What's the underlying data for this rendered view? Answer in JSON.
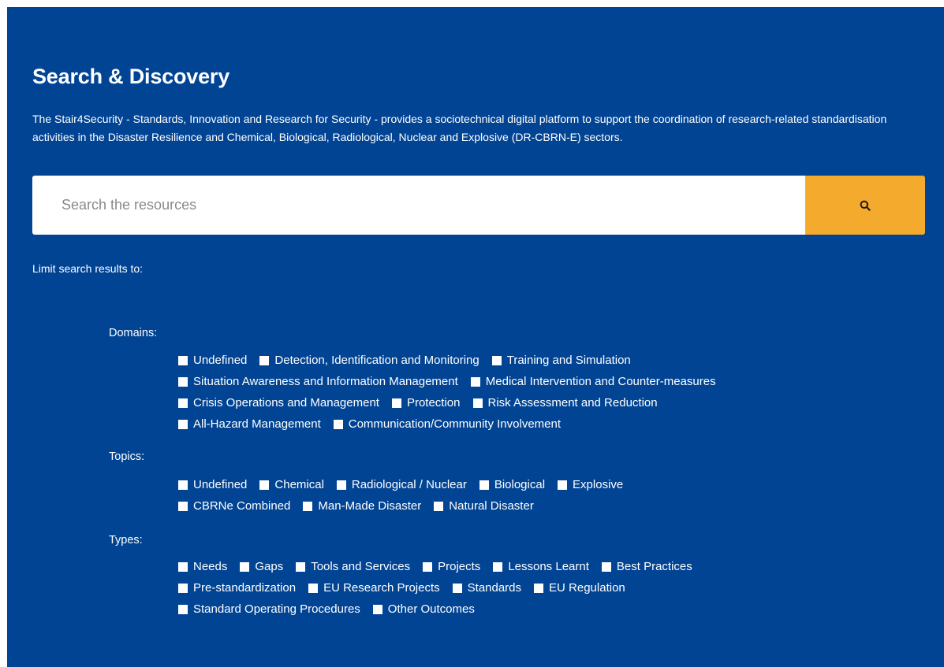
{
  "header": {
    "title": "Search & Discovery",
    "description": "The Stair4Security - Standards, Innovation and Research for Security - provides a sociotechnical digital platform to support the coordination of research-related standardisation activities in the Disaster Resilience and Chemical, Biological, Radiological, Nuclear and Explosive (DR-CBRN-E) sectors."
  },
  "search": {
    "placeholder": "Search the resources",
    "value": "",
    "button_icon": "search-icon"
  },
  "colors": {
    "background": "#024494",
    "accent": "#f4aa2c",
    "text": "#ffffff"
  },
  "filters": {
    "label": "Limit search results to:",
    "domains": {
      "label": "Domains:",
      "rows": [
        [
          "Undefined",
          "Detection, Identification and Monitoring",
          "Training and Simulation"
        ],
        [
          "Situation Awareness and Information Management",
          "Medical Intervention and Counter-measures"
        ],
        [
          "Crisis Operations and Management",
          "Protection",
          "Risk Assessment and Reduction"
        ],
        [
          "All-Hazard Management",
          "Communication/Community Involvement"
        ]
      ]
    },
    "topics": {
      "label": "Topics:",
      "rows": [
        [
          "Undefined",
          "Chemical",
          "Radiological / Nuclear",
          "Biological",
          "Explosive"
        ],
        [
          "CBRNe Combined",
          "Man-Made Disaster",
          "Natural Disaster"
        ]
      ]
    },
    "types": {
      "label": "Types:",
      "rows": [
        [
          "Needs",
          "Gaps",
          "Tools and Services",
          "Projects",
          "Lessons Learnt",
          "Best Practices"
        ],
        [
          "Pre-standardization",
          "EU Research Projects",
          "Standards",
          "EU Regulation"
        ],
        [
          "Standard Operating Procedures",
          "Other Outcomes"
        ]
      ]
    }
  }
}
